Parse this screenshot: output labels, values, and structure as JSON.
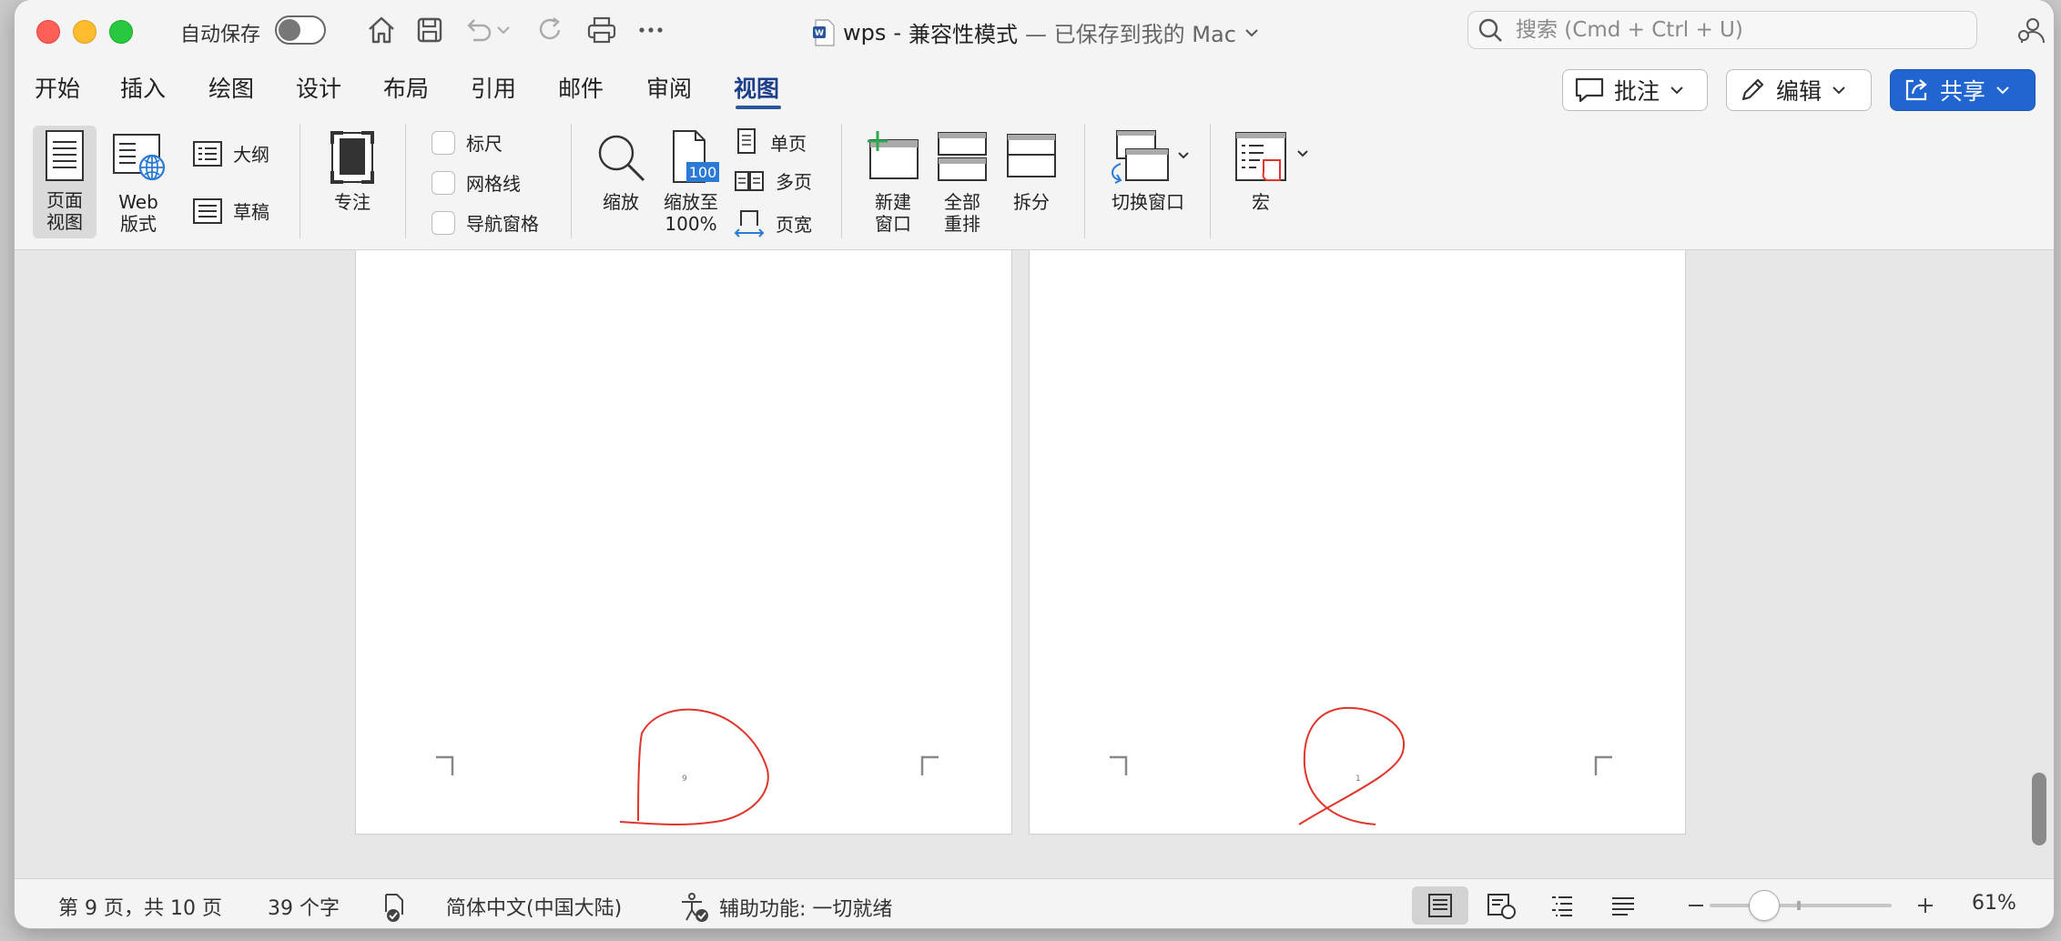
{
  "titlebar": {
    "autosave_label": "自动保存",
    "doc_name": "wps",
    "mode": "兼容性模式",
    "save_status": "— 已保存到我的 Mac"
  },
  "search": {
    "placeholder": "搜索 (Cmd + Ctrl + U)"
  },
  "tabs": [
    {
      "label": "开始"
    },
    {
      "label": "插入"
    },
    {
      "label": "绘图"
    },
    {
      "label": "设计"
    },
    {
      "label": "布局"
    },
    {
      "label": "引用"
    },
    {
      "label": "邮件"
    },
    {
      "label": "审阅"
    },
    {
      "label": "视图",
      "active": true
    }
  ],
  "top_buttons": {
    "comments": "批注",
    "edit": "编辑",
    "share": "共享"
  },
  "ribbon": {
    "page_view": "页面\n视图",
    "web_layout": "Web\n版式",
    "outline": "大纲",
    "draft": "草稿",
    "focus": "专注",
    "ruler": "标尺",
    "gridlines": "网格线",
    "nav_pane": "导航窗格",
    "zoom": "缩放",
    "zoom_100": "缩放至\n100%",
    "zoom_100_badge": "100",
    "one_page": "单页",
    "multiple_pages": "多页",
    "page_width": "页宽",
    "new_window": "新建\n窗口",
    "arrange_all": "全部\n重排",
    "split": "拆分",
    "switch_windows": "切换窗口",
    "macros": "宏"
  },
  "pages": [
    {
      "number": "9"
    },
    {
      "number": "1"
    }
  ],
  "status": {
    "page_info": "第 9 页，共 10 页",
    "word_count": "39 个字",
    "language": "简体中文(中国大陆)",
    "accessibility": "辅助功能: 一切就绪",
    "zoom": "61%",
    "zoom_level": 0.3
  },
  "colors": {
    "accent": "#2b579a",
    "share": "#2165d1",
    "annotation": "#e0352b"
  }
}
